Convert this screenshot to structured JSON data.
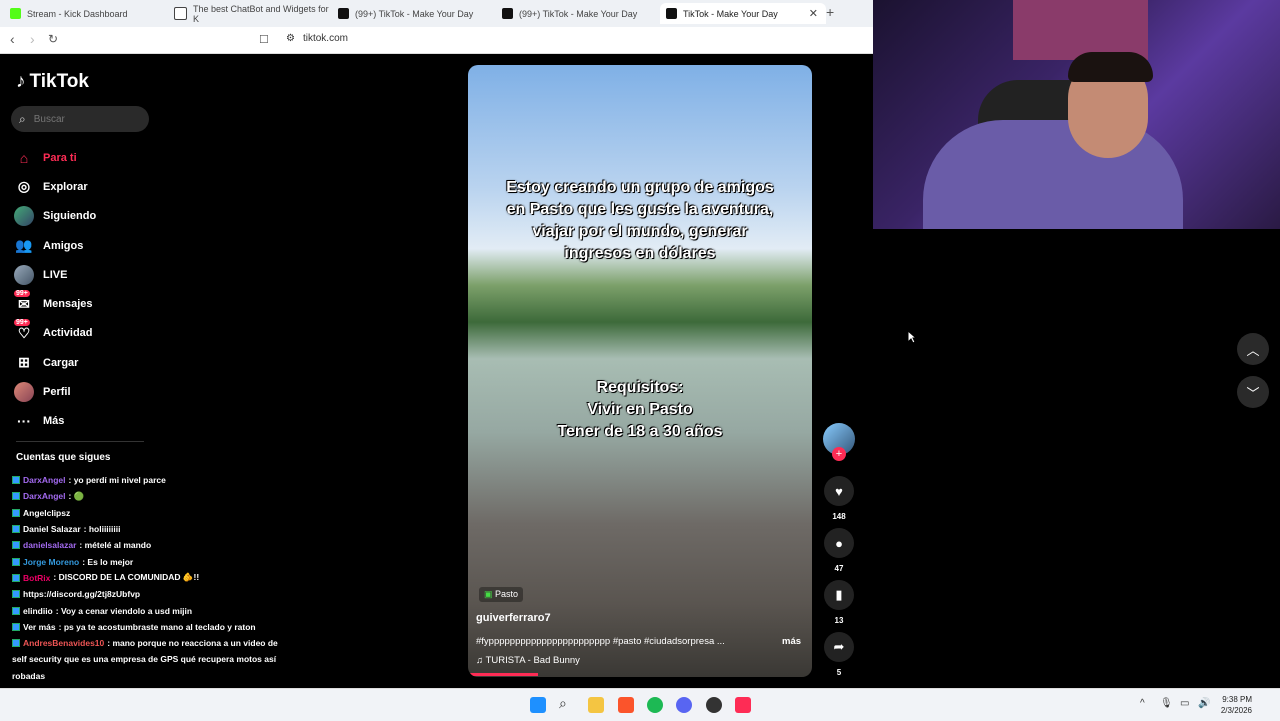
{
  "browser": {
    "tabs": [
      {
        "label": "Stream - Kick Dashboard",
        "color": "#53fc18"
      },
      {
        "label": "The best ChatBot and Widgets for K",
        "color": "#444444"
      },
      {
        "label": "(99+) TikTok - Make Your Day",
        "color": "#111111"
      },
      {
        "label": "(99+) TikTok - Make Your Day",
        "color": "#111111"
      },
      {
        "label": "TikTok - Make Your Day",
        "color": "#111111"
      }
    ],
    "url": "tiktok.com"
  },
  "tiktok": {
    "logo": "TikTok",
    "search_placeholder": "Buscar",
    "nav": [
      {
        "label": "Para ti",
        "icon": "home-icon"
      },
      {
        "label": "Explorar",
        "icon": "compass-icon"
      },
      {
        "label": "Siguiendo",
        "icon": "avatar"
      },
      {
        "label": "Amigos",
        "icon": "friends-icon"
      },
      {
        "label": "LIVE",
        "icon": "live-icon"
      },
      {
        "label": "Mensajes",
        "icon": "messages-icon",
        "badge": "99+"
      },
      {
        "label": "Actividad",
        "icon": "activity-icon",
        "badge": "99+"
      },
      {
        "label": "Cargar",
        "icon": "upload-icon"
      },
      {
        "label": "Perfil",
        "icon": "profile-icon"
      },
      {
        "label": "Más",
        "icon": "more-icon"
      }
    ],
    "following_title": "Cuentas que sigues",
    "video": {
      "caption_top": [
        "Estoy creando un grupo de amigos",
        "en Pasto que les guste la aventura,",
        "viajar por el mundo, generar",
        "ingresos en dólares"
      ],
      "caption_bottom": [
        "Requisitos:",
        "Vivir en Pasto",
        "Tener de 18 a 30 años"
      ],
      "location": "Pasto",
      "author": "guiverferraro7",
      "description": "#fyppppppppppppppppppppppp #pasto #ciudadsorpresa ...",
      "more": "más",
      "music": "TURISTA - Bad Bunny"
    },
    "actions": {
      "likes": "148",
      "comments": "47",
      "saves": "13",
      "shares": "5"
    }
  },
  "chat": [
    {
      "parts": [
        {
          "t": "DarxAngel",
          "c": "u1"
        },
        {
          "t": ": yo perdí mi nivel parce",
          "c": ""
        }
      ]
    },
    {
      "parts": [
        {
          "t": "DarxAngel",
          "c": "u1"
        },
        {
          "t": ": 🟢",
          "c": ""
        }
      ]
    },
    {
      "parts": [
        {
          "t": "Angelclipsz",
          "c": ""
        }
      ]
    },
    {
      "parts": [
        {
          "t": "Daniel Salazar",
          "c": ""
        },
        {
          "t": " : holiiiiiiii",
          "c": ""
        }
      ]
    },
    {
      "parts": [
        {
          "t": "danielsalazar",
          "c": "u1"
        },
        {
          "t": " : mételé al mando",
          "c": ""
        }
      ]
    },
    {
      "parts": [
        {
          "t": "Jorge Moreno",
          "c": "u2"
        },
        {
          "t": " : Es lo mejor",
          "c": ""
        }
      ]
    },
    {
      "parts": [
        {
          "t": "BotRix",
          "c": "u4"
        },
        {
          "t": " : DISCORD DE LA COMUNIDAD 🫵!!",
          "c": ""
        }
      ]
    },
    {
      "parts": [
        {
          "t": "https://discord.gg/2tj8zUbfvp",
          "c": ""
        }
      ]
    },
    {
      "parts": [
        {
          "t": "elindiio",
          "c": ""
        },
        {
          "t": " : Voy a cenar viendolo a usd mijin",
          "c": ""
        }
      ]
    },
    {
      "parts": [
        {
          "t": "Ver más",
          "c": ""
        },
        {
          "t": " : ps ya te acostumbraste mano al teclado y raton",
          "c": ""
        }
      ]
    },
    {
      "parts": [
        {
          "t": "AndresBenavides10",
          "c": "u3"
        },
        {
          "t": " : mano porque no reacciona a un video de",
          "c": ""
        }
      ]
    },
    {
      "parts": [
        {
          "t": "self security que es una empresa de GPS qué recupera motos así",
          "c": ""
        }
      ]
    },
    {
      "parts": [
        {
          "t": "robadas",
          "c": ""
        }
      ]
    }
  ],
  "taskbar": {
    "time": "9:38 PM",
    "date": "2/3/2026"
  }
}
